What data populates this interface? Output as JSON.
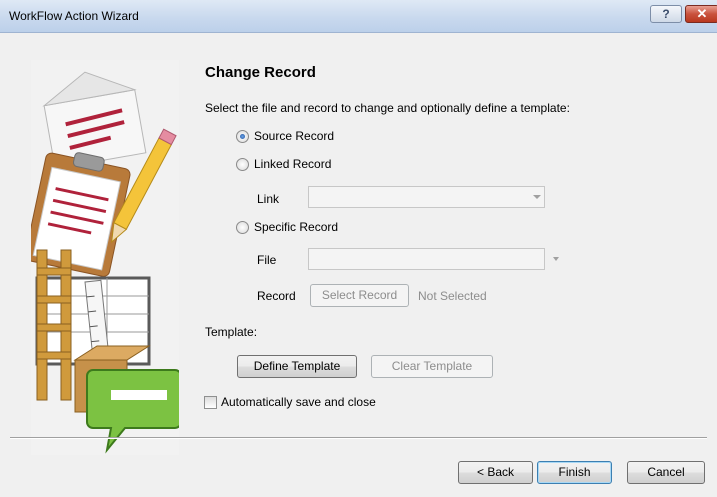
{
  "window": {
    "title": "WorkFlow Action Wizard",
    "help_glyph": "?",
    "close_glyph": "✕"
  },
  "page": {
    "heading": "Change Record",
    "instruction": "Select the file and record to change and optionally define a template:"
  },
  "options": {
    "source_record": "Source Record",
    "linked_record": "Linked Record",
    "link_label": "Link",
    "link_value": "",
    "specific_record": "Specific Record",
    "file_label": "File",
    "file_value": "",
    "record_label": "Record",
    "select_record_button": "Select Record",
    "record_status": "Not Selected",
    "selected": "source_record"
  },
  "template": {
    "label": "Template:",
    "define_button": "Define Template",
    "clear_button": "Clear Template"
  },
  "auto_save": {
    "label": "Automatically save and close",
    "checked": false
  },
  "footer": {
    "back_button": "< Back",
    "finish_button": "Finish",
    "cancel_button": "Cancel"
  },
  "colors": {
    "envelope_stripe": "#b0223b",
    "bubble_green": "#7cc242",
    "pencil_yellow": "#f4c43a"
  },
  "icons": [
    "help-icon",
    "close-icon",
    "wizard-banner-illustration",
    "dropdown-arrow-icon"
  ]
}
